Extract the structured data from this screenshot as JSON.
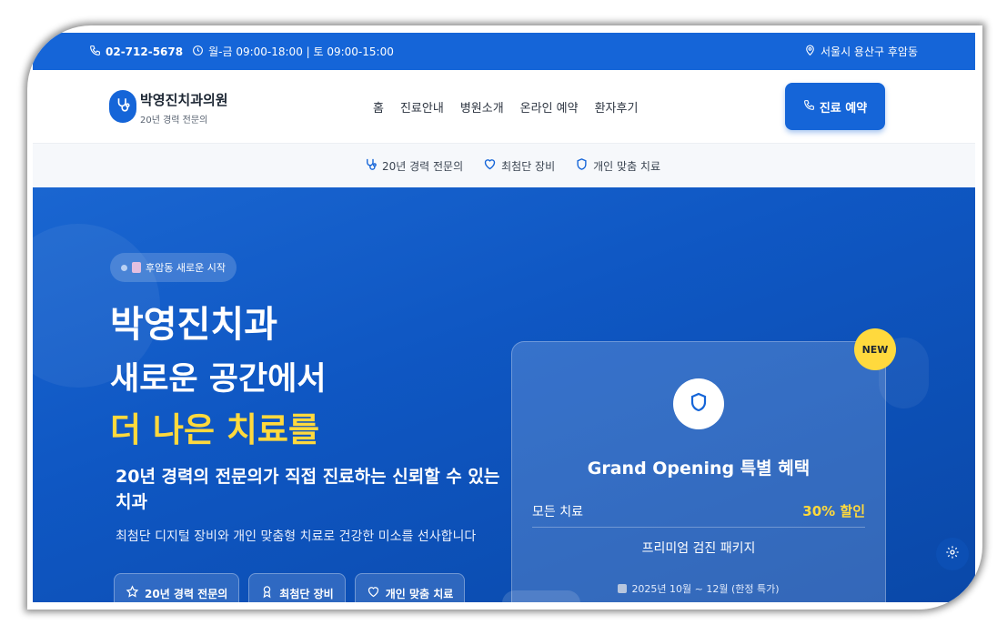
{
  "topbar": {
    "phone": "02-712-5678",
    "hours": "월-금 09:00-18:00 | 토 09:00-15:00",
    "address": "서울시 용산구 후암동"
  },
  "header": {
    "brand_name": "박영진치과의원",
    "brand_sub": "20년 경력 전문의",
    "nav": [
      "홈",
      "진료안내",
      "병원소개",
      "온라인 예약",
      "환자후기"
    ],
    "cta_label": "진료 예약"
  },
  "strip": {
    "items": [
      "20년 경력 전문의",
      "최첨단 장비",
      "개인 맞춤 치료"
    ]
  },
  "hero": {
    "badge": "후암동 새로운 시작",
    "title_line1": "박영진치과",
    "title_line2": "새로운 공간에서",
    "title_line3": "더 나은 치료를",
    "subtitle": "20년 경력의 전문의가 직접 진료하는 신뢰할 수 있는 치과",
    "description": "최첨단 디지털 장비와 개인 맞춤형 치료로 건강한 미소를 선사합니다",
    "chips": [
      "20년 경력 전문의",
      "최첨단 장비",
      "개인 맞춤 치료"
    ]
  },
  "promo": {
    "new_badge": "NEW",
    "title": "Grand Opening 특별 혜택",
    "row_label": "모든 치료",
    "row_value": "30% 할인",
    "package": "프리미엄 검진 패키지",
    "date": "2025년 10월 ~ 12월 (한정 특가)"
  },
  "colors": {
    "primary": "#1565d8",
    "accent": "#ffd93d"
  }
}
